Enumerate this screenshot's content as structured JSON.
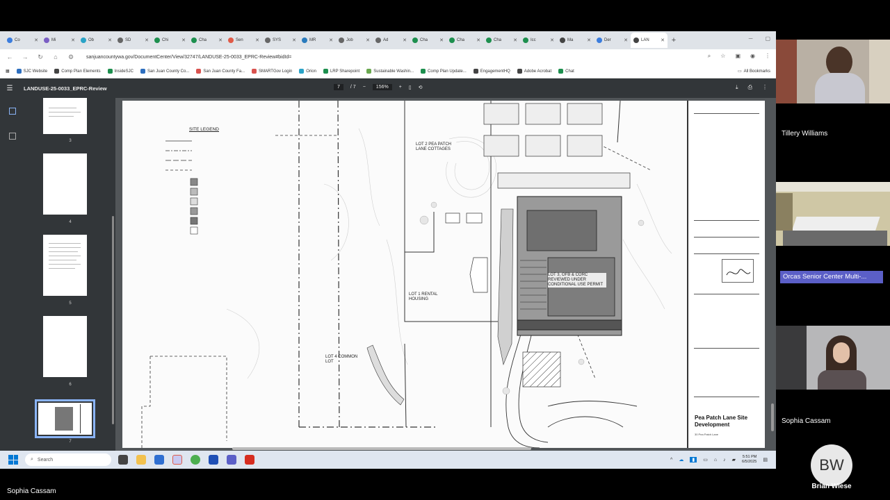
{
  "browser": {
    "tabs": [
      {
        "label": "Co",
        "color": "#3b7ddd"
      },
      {
        "label": "Mi",
        "color": "#7a5ec4"
      },
      {
        "label": "Ob",
        "color": "#2aa3c7"
      },
      {
        "label": "SD",
        "color": "#666666"
      },
      {
        "label": "Chi",
        "color": "#1d8f4e"
      },
      {
        "label": "Cha",
        "color": "#1d8f4e"
      },
      {
        "label": "Sen",
        "color": "#e05a47"
      },
      {
        "label": "SYS",
        "color": "#666666"
      },
      {
        "label": "MR",
        "color": "#2a7bbd"
      },
      {
        "label": "Job",
        "color": "#666666"
      },
      {
        "label": "Ad",
        "color": "#666666"
      },
      {
        "label": "Cha",
        "color": "#1d8f4e"
      },
      {
        "label": "Cha",
        "color": "#1d8f4e"
      },
      {
        "label": "Cha",
        "color": "#1d8f4e"
      },
      {
        "label": "Icc",
        "color": "#1d8f4e"
      },
      {
        "label": "Ma",
        "color": "#444444"
      },
      {
        "label": "Der",
        "color": "#3b7ddd"
      },
      {
        "label": "LAN",
        "color": "#444444",
        "active": true
      }
    ],
    "url": "sanjuancountywa.gov/DocumentCenter/View/32747/LANDUSE-25-0033_EPRC-Review#bidId=",
    "bookmarks": [
      {
        "label": "SJC Website",
        "color": "#2e6fbf"
      },
      {
        "label": "Comp Plan Elements",
        "color": "#444444"
      },
      {
        "label": "InsideSJC",
        "color": "#1d8f4e"
      },
      {
        "label": "San Juan County Co...",
        "color": "#2e6fbf"
      },
      {
        "label": "San Juan County Fa...",
        "color": "#d9534f"
      },
      {
        "label": "SMARTGov Login",
        "color": "#d9534f"
      },
      {
        "label": "Orion",
        "color": "#2aa3c7"
      },
      {
        "label": "LRP Sharepoint",
        "color": "#1d8f4e"
      },
      {
        "label": "Sustainable Washin...",
        "color": "#6aa84f"
      },
      {
        "label": "Comp Plan Update...",
        "color": "#1d8f4e"
      },
      {
        "label": "EngagementHQ",
        "color": "#444444"
      },
      {
        "label": "Adobe Acrobat",
        "color": "#444444"
      },
      {
        "label": "Chat",
        "color": "#1d8f4e"
      }
    ],
    "all_bookmarks": "All Bookmarks"
  },
  "pdf": {
    "title": "LANDUSE-25-0033_EPRC-Review",
    "page_current": "7",
    "page_total": "/ 7",
    "zoom": "156%",
    "thumb_numbers": [
      "3",
      "4",
      "5",
      "6",
      "7"
    ]
  },
  "drawing": {
    "legend_title": "SITE LEGEND",
    "lot2": "LOT 2 PEA PATCH LANE COTTAGES",
    "lot1": "LOT 1 RENTAL HOUSING",
    "lot3": "LOT 3, OFB & CORC REVIEWED UNDER CONDITIONAL USE PERMIT",
    "lot4": "LOT 4 COMMON LOT",
    "project_title": "Pea Patch Lane Site Development",
    "project_sub": "30 Pea Patch Lane"
  },
  "taskbar": {
    "search_placeholder": "Search",
    "time": "5:51 PM",
    "date": "6/5/2025"
  },
  "meeting": {
    "participants": [
      {
        "name": "Tillery Williams"
      },
      {
        "name": "Orcas Senior Center Multi-..."
      },
      {
        "name": "Sophia Cassam"
      },
      {
        "name": "Brian Wiese",
        "initials": "BW"
      }
    ],
    "active_speaker": "Sophia Cassam"
  }
}
